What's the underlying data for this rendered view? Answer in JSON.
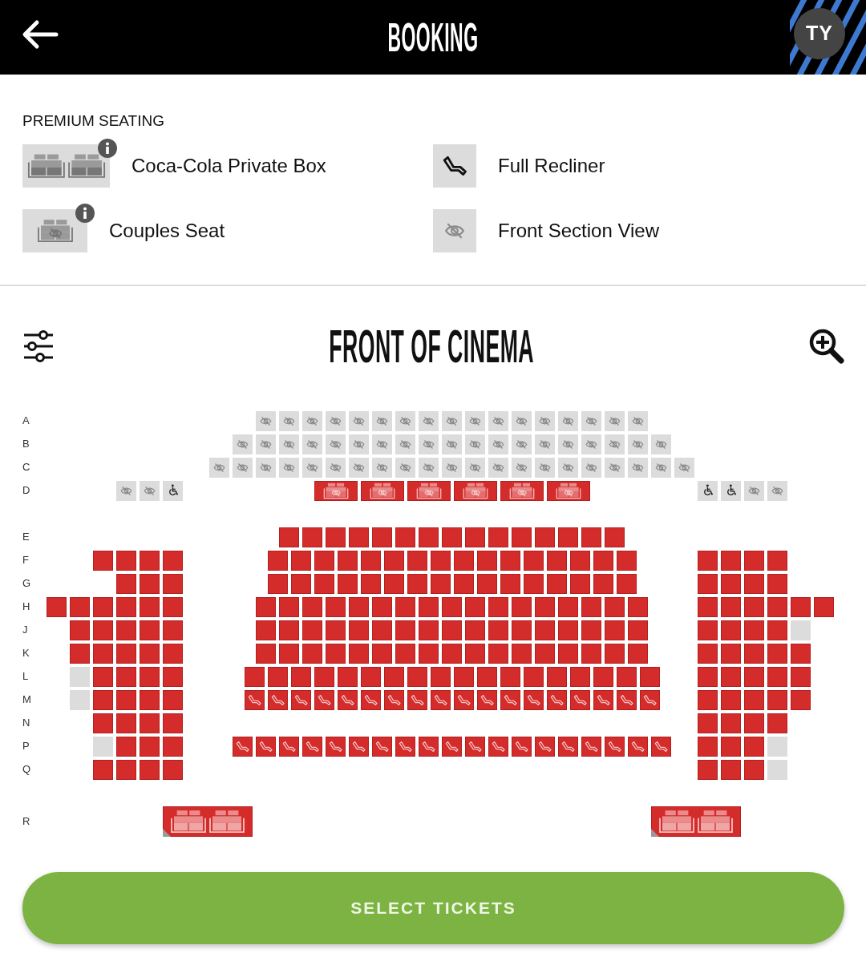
{
  "header": {
    "title": "BOOKING",
    "avatar": "TY"
  },
  "legend": {
    "title": "PREMIUM SEATING",
    "items": [
      {
        "kind": "private_box",
        "label": "Coca-Cola Private Box",
        "info": true
      },
      {
        "kind": "recliner",
        "label": "Full Recliner",
        "info": false
      },
      {
        "kind": "couples",
        "label": "Couples Seat",
        "info": true
      },
      {
        "kind": "front_view",
        "label": "Front Section View",
        "info": false
      }
    ]
  },
  "seat_map": {
    "title": "FRONT OF CINEMA",
    "row_groups": [
      {
        "rows": [
          {
            "label": "A",
            "center": [
              {
                "kind": "front_view",
                "available": false
              },
              {
                "kind": "front_view",
                "available": false
              },
              {
                "kind": "front_view",
                "available": false
              },
              {
                "kind": "front_view",
                "available": false
              },
              {
                "kind": "front_view",
                "available": false
              },
              {
                "kind": "front_view",
                "available": false
              },
              {
                "kind": "front_view",
                "available": false
              },
              {
                "kind": "front_view",
                "available": false
              },
              {
                "kind": "front_view",
                "available": false
              },
              {
                "kind": "front_view",
                "available": false
              },
              {
                "kind": "front_view",
                "available": false
              },
              {
                "kind": "front_view",
                "available": false
              },
              {
                "kind": "front_view",
                "available": false
              },
              {
                "kind": "front_view",
                "available": false
              },
              {
                "kind": "front_view",
                "available": false
              },
              {
                "kind": "front_view",
                "available": false
              },
              {
                "kind": "front_view",
                "available": false
              }
            ]
          },
          {
            "label": "B",
            "center": [
              {
                "kind": "front_view",
                "available": false
              },
              {
                "kind": "front_view",
                "available": false
              },
              {
                "kind": "front_view",
                "available": false
              },
              {
                "kind": "front_view",
                "available": false
              },
              {
                "kind": "front_view",
                "available": false
              },
              {
                "kind": "front_view",
                "available": false
              },
              {
                "kind": "front_view",
                "available": false
              },
              {
                "kind": "front_view",
                "available": false
              },
              {
                "kind": "front_view",
                "available": false
              },
              {
                "kind": "front_view",
                "available": false
              },
              {
                "kind": "front_view",
                "available": false
              },
              {
                "kind": "front_view",
                "available": false
              },
              {
                "kind": "front_view",
                "available": false
              },
              {
                "kind": "front_view",
                "available": false
              },
              {
                "kind": "front_view",
                "available": false
              },
              {
                "kind": "front_view",
                "available": false
              },
              {
                "kind": "front_view",
                "available": false
              },
              {
                "kind": "front_view",
                "available": false
              },
              {
                "kind": "front_view",
                "available": false
              }
            ]
          },
          {
            "label": "C",
            "center": [
              {
                "kind": "front_view",
                "available": false
              },
              {
                "kind": "front_view",
                "available": false
              },
              {
                "kind": "front_view",
                "available": false
              },
              {
                "kind": "front_view",
                "available": false
              },
              {
                "kind": "front_view",
                "available": false
              },
              {
                "kind": "front_view",
                "available": false
              },
              {
                "kind": "front_view",
                "available": false
              },
              {
                "kind": "front_view",
                "available": false
              },
              {
                "kind": "front_view",
                "available": false
              },
              {
                "kind": "front_view",
                "available": false
              },
              {
                "kind": "front_view",
                "available": false
              },
              {
                "kind": "front_view",
                "available": false
              },
              {
                "kind": "front_view",
                "available": false
              },
              {
                "kind": "front_view",
                "available": false
              },
              {
                "kind": "front_view",
                "available": false
              },
              {
                "kind": "front_view",
                "available": false
              },
              {
                "kind": "front_view",
                "available": false
              },
              {
                "kind": "front_view",
                "available": false
              },
              {
                "kind": "front_view",
                "available": false
              },
              {
                "kind": "front_view",
                "available": false
              },
              {
                "kind": "front_view",
                "available": false
              }
            ]
          },
          {
            "label": "D",
            "left": [
              {
                "kind": "front_view",
                "available": false
              },
              {
                "kind": "front_view",
                "available": false
              },
              {
                "kind": "wheelchair",
                "available": false
              }
            ],
            "center": [
              {
                "kind": "couples",
                "available": true
              },
              {
                "kind": "couples",
                "available": true
              },
              {
                "kind": "couples",
                "available": true
              },
              {
                "kind": "couples",
                "available": true
              },
              {
                "kind": "couples",
                "available": true
              },
              {
                "kind": "couples",
                "available": true
              }
            ],
            "right": [
              {
                "kind": "wheelchair",
                "available": false
              },
              {
                "kind": "wheelchair",
                "available": false
              },
              {
                "kind": "front_view",
                "available": false
              },
              {
                "kind": "front_view",
                "available": false
              }
            ]
          }
        ]
      },
      {
        "rows": [
          {
            "label": "E",
            "center": [
              {
                "kind": "standard",
                "available": true
              },
              {
                "kind": "standard",
                "available": true
              },
              {
                "kind": "standard",
                "available": true
              },
              {
                "kind": "standard",
                "available": true
              },
              {
                "kind": "standard",
                "available": true
              },
              {
                "kind": "standard",
                "available": true
              },
              {
                "kind": "standard",
                "available": true
              },
              {
                "kind": "standard",
                "available": true
              },
              {
                "kind": "standard",
                "available": true
              },
              {
                "kind": "standard",
                "available": true
              },
              {
                "kind": "standard",
                "available": true
              },
              {
                "kind": "standard",
                "available": true
              },
              {
                "kind": "standard",
                "available": true
              },
              {
                "kind": "standard",
                "available": true
              },
              {
                "kind": "standard",
                "available": true
              }
            ]
          },
          {
            "label": "F",
            "left": [
              {
                "kind": "standard",
                "available": true
              },
              {
                "kind": "standard",
                "available": true
              },
              {
                "kind": "standard",
                "available": true
              },
              {
                "kind": "standard",
                "available": true
              }
            ],
            "center": [
              {
                "kind": "standard",
                "available": true
              },
              {
                "kind": "standard",
                "available": true
              },
              {
                "kind": "standard",
                "available": true
              },
              {
                "kind": "standard",
                "available": true
              },
              {
                "kind": "standard",
                "available": true
              },
              {
                "kind": "standard",
                "available": true
              },
              {
                "kind": "standard",
                "available": true
              },
              {
                "kind": "standard",
                "available": true
              },
              {
                "kind": "standard",
                "available": true
              },
              {
                "kind": "standard",
                "available": true
              },
              {
                "kind": "standard",
                "available": true
              },
              {
                "kind": "standard",
                "available": true
              },
              {
                "kind": "standard",
                "available": true
              },
              {
                "kind": "standard",
                "available": true
              },
              {
                "kind": "standard",
                "available": true
              },
              {
                "kind": "standard",
                "available": true
              }
            ],
            "right": [
              {
                "kind": "standard",
                "available": true
              },
              {
                "kind": "standard",
                "available": true
              },
              {
                "kind": "standard",
                "available": true
              },
              {
                "kind": "standard",
                "available": true
              }
            ]
          },
          {
            "label": "G",
            "left": [
              {
                "kind": "standard",
                "available": true
              },
              {
                "kind": "standard",
                "available": true
              },
              {
                "kind": "standard",
                "available": true
              }
            ],
            "center": [
              {
                "kind": "standard",
                "available": true
              },
              {
                "kind": "standard",
                "available": true
              },
              {
                "kind": "standard",
                "available": true
              },
              {
                "kind": "standard",
                "available": true
              },
              {
                "kind": "standard",
                "available": true
              },
              {
                "kind": "standard",
                "available": true
              },
              {
                "kind": "standard",
                "available": true
              },
              {
                "kind": "standard",
                "available": true
              },
              {
                "kind": "standard",
                "available": true
              },
              {
                "kind": "standard",
                "available": true
              },
              {
                "kind": "standard",
                "available": true
              },
              {
                "kind": "standard",
                "available": true
              },
              {
                "kind": "standard",
                "available": true
              },
              {
                "kind": "standard",
                "available": true
              },
              {
                "kind": "standard",
                "available": true
              },
              {
                "kind": "standard",
                "available": true
              }
            ],
            "right": [
              {
                "kind": "standard",
                "available": true
              },
              {
                "kind": "standard",
                "available": true
              },
              {
                "kind": "standard",
                "available": true
              },
              {
                "kind": "standard",
                "available": true
              }
            ]
          },
          {
            "label": "H",
            "left": [
              {
                "kind": "standard",
                "available": true
              },
              {
                "kind": "standard",
                "available": true
              },
              {
                "kind": "standard",
                "available": true
              },
              {
                "kind": "standard",
                "available": true
              },
              {
                "kind": "standard",
                "available": true
              },
              {
                "kind": "standard",
                "available": true
              }
            ],
            "center": [
              {
                "kind": "standard",
                "available": true
              },
              {
                "kind": "standard",
                "available": true
              },
              {
                "kind": "standard",
                "available": true
              },
              {
                "kind": "standard",
                "available": true
              },
              {
                "kind": "standard",
                "available": true
              },
              {
                "kind": "standard",
                "available": true
              },
              {
                "kind": "standard",
                "available": true
              },
              {
                "kind": "standard",
                "available": true
              },
              {
                "kind": "standard",
                "available": true
              },
              {
                "kind": "standard",
                "available": true
              },
              {
                "kind": "standard",
                "available": true
              },
              {
                "kind": "standard",
                "available": true
              },
              {
                "kind": "standard",
                "available": true
              },
              {
                "kind": "standard",
                "available": true
              },
              {
                "kind": "standard",
                "available": true
              },
              {
                "kind": "standard",
                "available": true
              },
              {
                "kind": "standard",
                "available": true
              }
            ],
            "right": [
              {
                "kind": "standard",
                "available": true
              },
              {
                "kind": "standard",
                "available": true
              },
              {
                "kind": "standard",
                "available": true
              },
              {
                "kind": "standard",
                "available": true
              },
              {
                "kind": "standard",
                "available": true
              },
              {
                "kind": "standard",
                "available": true
              }
            ]
          },
          {
            "label": "J",
            "left": [
              {
                "kind": "standard",
                "available": true
              },
              {
                "kind": "standard",
                "available": true
              },
              {
                "kind": "standard",
                "available": true
              },
              {
                "kind": "standard",
                "available": true
              },
              {
                "kind": "standard",
                "available": true
              }
            ],
            "center": [
              {
                "kind": "standard",
                "available": true
              },
              {
                "kind": "standard",
                "available": true
              },
              {
                "kind": "standard",
                "available": true
              },
              {
                "kind": "standard",
                "available": true
              },
              {
                "kind": "standard",
                "available": true
              },
              {
                "kind": "standard",
                "available": true
              },
              {
                "kind": "standard",
                "available": true
              },
              {
                "kind": "standard",
                "available": true
              },
              {
                "kind": "standard",
                "available": true
              },
              {
                "kind": "standard",
                "available": true
              },
              {
                "kind": "standard",
                "available": true
              },
              {
                "kind": "standard",
                "available": true
              },
              {
                "kind": "standard",
                "available": true
              },
              {
                "kind": "standard",
                "available": true
              },
              {
                "kind": "standard",
                "available": true
              },
              {
                "kind": "standard",
                "available": true
              },
              {
                "kind": "standard",
                "available": true
              }
            ],
            "right": [
              {
                "kind": "standard",
                "available": true
              },
              {
                "kind": "standard",
                "available": true
              },
              {
                "kind": "standard",
                "available": true
              },
              {
                "kind": "standard",
                "available": true
              },
              {
                "kind": "standard",
                "available": false
              }
            ]
          },
          {
            "label": "K",
            "left": [
              {
                "kind": "standard",
                "available": true
              },
              {
                "kind": "standard",
                "available": true
              },
              {
                "kind": "standard",
                "available": true
              },
              {
                "kind": "standard",
                "available": true
              },
              {
                "kind": "standard",
                "available": true
              }
            ],
            "center": [
              {
                "kind": "standard",
                "available": true
              },
              {
                "kind": "standard",
                "available": true
              },
              {
                "kind": "standard",
                "available": true
              },
              {
                "kind": "standard",
                "available": true
              },
              {
                "kind": "standard",
                "available": true
              },
              {
                "kind": "standard",
                "available": true
              },
              {
                "kind": "standard",
                "available": true
              },
              {
                "kind": "standard",
                "available": true
              },
              {
                "kind": "standard",
                "available": true
              },
              {
                "kind": "standard",
                "available": true
              },
              {
                "kind": "standard",
                "available": true
              },
              {
                "kind": "standard",
                "available": true
              },
              {
                "kind": "standard",
                "available": true
              },
              {
                "kind": "standard",
                "available": true
              },
              {
                "kind": "standard",
                "available": true
              },
              {
                "kind": "standard",
                "available": true
              },
              {
                "kind": "standard",
                "available": true
              }
            ],
            "right": [
              {
                "kind": "standard",
                "available": true
              },
              {
                "kind": "standard",
                "available": true
              },
              {
                "kind": "standard",
                "available": true
              },
              {
                "kind": "standard",
                "available": true
              },
              {
                "kind": "standard",
                "available": true
              }
            ]
          },
          {
            "label": "L",
            "left": [
              {
                "kind": "standard",
                "available": false
              },
              {
                "kind": "standard",
                "available": true
              },
              {
                "kind": "standard",
                "available": true
              },
              {
                "kind": "standard",
                "available": true
              },
              {
                "kind": "standard",
                "available": true
              }
            ],
            "center": [
              {
                "kind": "standard",
                "available": true
              },
              {
                "kind": "standard",
                "available": true
              },
              {
                "kind": "standard",
                "available": true
              },
              {
                "kind": "standard",
                "available": true
              },
              {
                "kind": "standard",
                "available": true
              },
              {
                "kind": "standard",
                "available": true
              },
              {
                "kind": "standard",
                "available": true
              },
              {
                "kind": "standard",
                "available": true
              },
              {
                "kind": "standard",
                "available": true
              },
              {
                "kind": "standard",
                "available": true
              },
              {
                "kind": "standard",
                "available": true
              },
              {
                "kind": "standard",
                "available": true
              },
              {
                "kind": "standard",
                "available": true
              },
              {
                "kind": "standard",
                "available": true
              },
              {
                "kind": "standard",
                "available": true
              },
              {
                "kind": "standard",
                "available": true
              },
              {
                "kind": "standard",
                "available": true
              },
              {
                "kind": "standard",
                "available": true
              }
            ],
            "right": [
              {
                "kind": "standard",
                "available": true
              },
              {
                "kind": "standard",
                "available": true
              },
              {
                "kind": "standard",
                "available": true
              },
              {
                "kind": "standard",
                "available": true
              },
              {
                "kind": "standard",
                "available": true
              }
            ]
          },
          {
            "label": "M",
            "left": [
              {
                "kind": "standard",
                "available": false
              },
              {
                "kind": "standard",
                "available": true
              },
              {
                "kind": "standard",
                "available": true
              },
              {
                "kind": "standard",
                "available": true
              },
              {
                "kind": "standard",
                "available": true
              }
            ],
            "center": [
              {
                "kind": "recliner",
                "available": true
              },
              {
                "kind": "recliner",
                "available": true
              },
              {
                "kind": "recliner",
                "available": true
              },
              {
                "kind": "recliner",
                "available": true
              },
              {
                "kind": "recliner",
                "available": true
              },
              {
                "kind": "recliner",
                "available": true
              },
              {
                "kind": "recliner",
                "available": true
              },
              {
                "kind": "recliner",
                "available": true
              },
              {
                "kind": "recliner",
                "available": true
              },
              {
                "kind": "recliner",
                "available": true
              },
              {
                "kind": "recliner",
                "available": true
              },
              {
                "kind": "recliner",
                "available": true
              },
              {
                "kind": "recliner",
                "available": true
              },
              {
                "kind": "recliner",
                "available": true
              },
              {
                "kind": "recliner",
                "available": true
              },
              {
                "kind": "recliner",
                "available": true
              },
              {
                "kind": "recliner",
                "available": true
              },
              {
                "kind": "recliner",
                "available": true
              }
            ],
            "right": [
              {
                "kind": "standard",
                "available": true
              },
              {
                "kind": "standard",
                "available": true
              },
              {
                "kind": "standard",
                "available": true
              },
              {
                "kind": "standard",
                "available": true
              },
              {
                "kind": "standard",
                "available": true
              }
            ]
          },
          {
            "label": "N",
            "left": [
              {
                "kind": "standard",
                "available": true
              },
              {
                "kind": "standard",
                "available": true
              },
              {
                "kind": "standard",
                "available": true
              },
              {
                "kind": "standard",
                "available": true
              }
            ],
            "right": [
              {
                "kind": "standard",
                "available": true
              },
              {
                "kind": "standard",
                "available": true
              },
              {
                "kind": "standard",
                "available": true
              },
              {
                "kind": "standard",
                "available": true
              }
            ]
          },
          {
            "label": "P",
            "left": [
              {
                "kind": "standard",
                "available": false
              },
              {
                "kind": "standard",
                "available": true
              },
              {
                "kind": "standard",
                "available": true
              },
              {
                "kind": "standard",
                "available": true
              }
            ],
            "center": [
              {
                "kind": "recliner",
                "available": true
              },
              {
                "kind": "recliner",
                "available": true
              },
              {
                "kind": "recliner",
                "available": true
              },
              {
                "kind": "recliner",
                "available": true
              },
              {
                "kind": "recliner",
                "available": true
              },
              {
                "kind": "recliner",
                "available": true
              },
              {
                "kind": "recliner",
                "available": true
              },
              {
                "kind": "recliner",
                "available": true
              },
              {
                "kind": "recliner",
                "available": true
              },
              {
                "kind": "recliner",
                "available": true
              },
              {
                "kind": "recliner",
                "available": true
              },
              {
                "kind": "recliner",
                "available": true
              },
              {
                "kind": "recliner",
                "available": true
              },
              {
                "kind": "recliner",
                "available": true
              },
              {
                "kind": "recliner",
                "available": true
              },
              {
                "kind": "recliner",
                "available": true
              },
              {
                "kind": "recliner",
                "available": true
              },
              {
                "kind": "recliner",
                "available": true
              },
              {
                "kind": "recliner",
                "available": true
              }
            ],
            "right": [
              {
                "kind": "standard",
                "available": true
              },
              {
                "kind": "standard",
                "available": true
              },
              {
                "kind": "standard",
                "available": true
              },
              {
                "kind": "standard",
                "available": false
              }
            ]
          },
          {
            "label": "Q",
            "left": [
              {
                "kind": "standard",
                "available": true
              },
              {
                "kind": "standard",
                "available": true
              },
              {
                "kind": "standard",
                "available": true
              },
              {
                "kind": "standard",
                "available": true
              }
            ],
            "right": [
              {
                "kind": "standard",
                "available": true
              },
              {
                "kind": "standard",
                "available": true
              },
              {
                "kind": "standard",
                "available": true
              },
              {
                "kind": "standard",
                "available": false
              }
            ]
          }
        ]
      },
      {
        "rows": [
          {
            "label": "R",
            "left": [
              {
                "kind": "private_box",
                "available": true
              }
            ],
            "right": [
              {
                "kind": "private_box",
                "available": true
              }
            ]
          }
        ]
      }
    ]
  },
  "button": {
    "label": "SELECT TICKETS"
  }
}
